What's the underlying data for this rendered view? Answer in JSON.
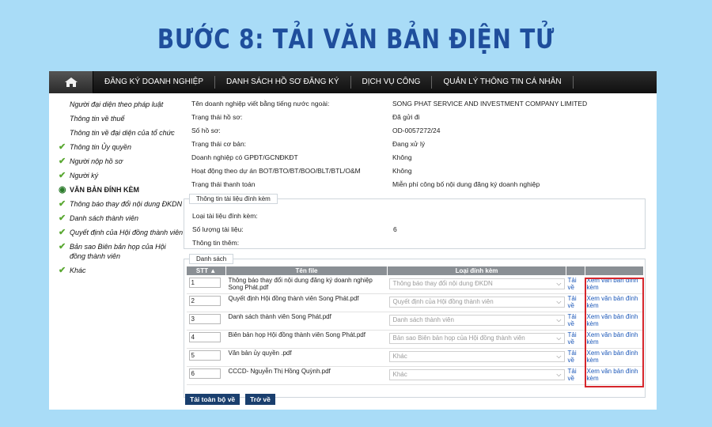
{
  "headline": "BƯỚC 8: TẢI VĂN BẢN ĐIỆN TỬ",
  "nav": [
    "ĐĂNG KÝ DOANH NGHIỆP",
    "DANH SÁCH HỒ SƠ ĐĂNG KÝ",
    "DỊCH VỤ CÔNG",
    "QUẢN LÝ THÔNG TIN CÁ NHÂN"
  ],
  "sidebar": [
    {
      "label": "Người đại diện theo pháp luật",
      "icon": "none"
    },
    {
      "label": "Thông tin về thuế",
      "icon": "none"
    },
    {
      "label": "Thông tin về đại diện của tổ chức",
      "icon": "none"
    },
    {
      "label": "Thông tin Ủy quyền",
      "icon": "check-icon"
    },
    {
      "label": "Người nộp hồ sơ",
      "icon": "check-icon"
    },
    {
      "label": "Người ký",
      "icon": "check-icon"
    },
    {
      "label": "VĂN BẢN ĐÍNH KÈM",
      "icon": "current-step-icon"
    },
    {
      "label": "Thông báo thay đổi nội dung ĐKDN",
      "icon": "check-icon"
    },
    {
      "label": "Danh sách thành viên",
      "icon": "check-icon"
    },
    {
      "label": "Quyết định của Hội đồng thành viên",
      "icon": "check-icon"
    },
    {
      "label": "Bản sao Biên bản họp của Hội đồng thành viên",
      "icon": "check-icon"
    },
    {
      "label": "Khác",
      "icon": "check-icon"
    }
  ],
  "info": [
    {
      "k": "Tên doanh nghiệp viết bằng tiếng nước ngoài:",
      "v": "SONG PHAT SERVICE AND INVESTMENT COMPANY LIMITED"
    },
    {
      "k": "Trạng thái hồ sơ:",
      "v": "Đã gửi đi"
    },
    {
      "k": "Số hồ sơ:",
      "v": "OD-0057272/24"
    },
    {
      "k": "Trạng thái cơ bản:",
      "v": "Đang xử lý"
    },
    {
      "k": "Doanh nghiệp có GPĐT/GCNĐKĐT",
      "v": "Không"
    },
    {
      "k": "Hoạt động theo dự án BOT/BTO/BT/BOO/BLT/BTL/O&M",
      "v": "Không"
    },
    {
      "k": "Trạng thái thanh toán",
      "v": "Miễn phí công bố nội dung đăng ký doanh nghiệp"
    }
  ],
  "attachment": {
    "legend": "Thông tin tài liệu đính kèm",
    "type_label": "Loại tài liệu đính kèm:",
    "count_label": "Số lượng tài liệu:",
    "count_value": "6",
    "extra_label": "Thông tin thêm:"
  },
  "list": {
    "legend": "Danh sách",
    "headers": [
      "STT",
      "Tên file",
      "Loại đính kèm"
    ],
    "rows": [
      {
        "stt": "1",
        "file": "Thông báo thay đổi nội dung đăng ký doanh nghiệp Song Phát.pdf",
        "type": "Thông báo thay đổi nội dung ĐKDN"
      },
      {
        "stt": "2",
        "file": "Quyết định Hội đồng thành viên Song Phát.pdf",
        "type": "Quyết định của Hội đồng thành viên"
      },
      {
        "stt": "3",
        "file": "Danh sách thành viên Song Phát.pdf",
        "type": "Danh sách thành viên"
      },
      {
        "stt": "4",
        "file": "Biên bản họp Hội đồng thành viên Song Phát.pdf",
        "type": "Bản sao Biên bản họp của Hội đồng thành viên"
      },
      {
        "stt": "5",
        "file": "Văn bản ủy quyền .pdf",
        "type": "Khác"
      },
      {
        "stt": "6",
        "file": "CCCD- Nguyễn Thị Hồng Quỳnh.pdf",
        "type": "Khác"
      }
    ],
    "download_label": "Tải về",
    "view_label": "Xem văn bản đính kèm"
  },
  "buttons": {
    "download_all": "Tải toàn bộ về",
    "back": "Trở về"
  },
  "colors": {
    "headline": "#1f4e9c",
    "button": "#1a3f6e",
    "highlight": "#d6262c",
    "check": "#5aa832"
  }
}
